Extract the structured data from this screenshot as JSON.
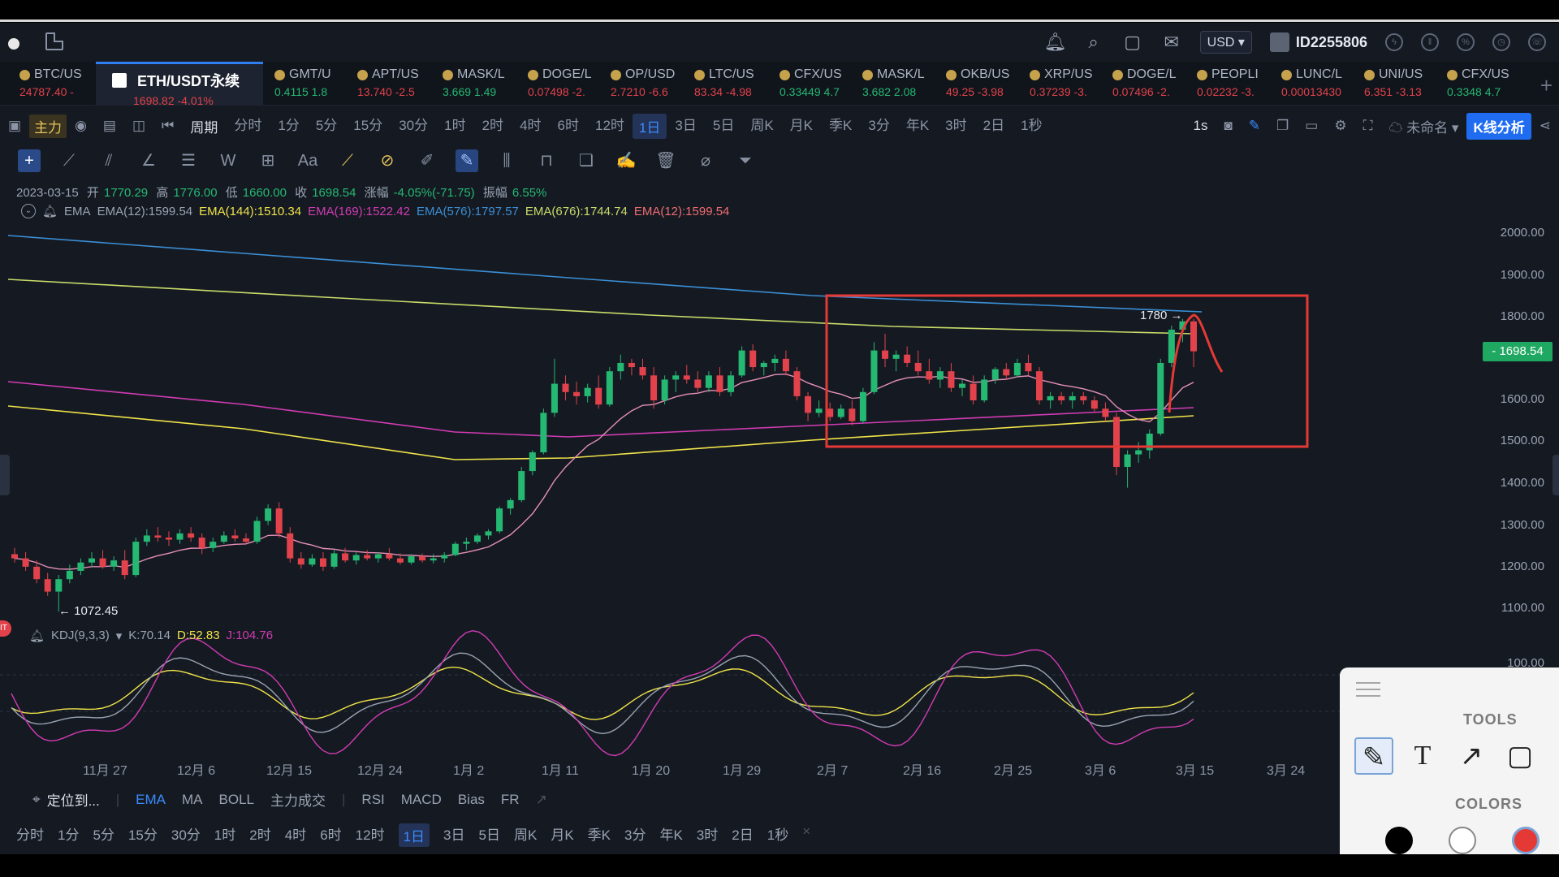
{
  "colors": {
    "up": "#25b873",
    "down": "#e2424b",
    "accent": "#2f7ff2",
    "bg": "#151a22"
  },
  "header": {
    "currency": "USD ▾",
    "user_id": "ID2255806",
    "icons": [
      "bell-icon",
      "search-icon",
      "gift-icon",
      "mail-icon"
    ]
  },
  "tabs": [
    {
      "name": "BTC/US",
      "price": "24787.40 -"
    },
    {
      "name": "ETH/USDT永续",
      "price": "1698.82 -4.01%"
    },
    {
      "name": "GMT/U",
      "price": "0.4115 1.8"
    },
    {
      "name": "APT/US",
      "price": "13.740 -2.5"
    },
    {
      "name": "MASK/L",
      "price": "3.669 1.49"
    },
    {
      "name": "DOGE/L",
      "price": "0.07498 -2."
    },
    {
      "name": "OP/USD",
      "price": "2.7210 -6.6"
    },
    {
      "name": "LTC/US",
      "price": "83.34 -4.98"
    },
    {
      "name": "CFX/US",
      "price": "0.33449 4.7"
    },
    {
      "name": "MASK/L",
      "price": "3.682 2.08"
    },
    {
      "name": "OKB/US",
      "price": "49.25 -3.98"
    },
    {
      "name": "XRP/US",
      "price": "0.37239 -3."
    },
    {
      "name": "DOGE/L",
      "price": "0.07496 -2."
    },
    {
      "name": "PEOPLI",
      "price": "0.02232 -3."
    },
    {
      "name": "LUNC/L",
      "price": "0.00013430"
    },
    {
      "name": "UNI/US",
      "price": "6.351 -3.13"
    },
    {
      "name": "CFX/US",
      "price": "0.3348 4.7"
    }
  ],
  "toolbar": {
    "main": "主力",
    "period": "周期",
    "periods": [
      "分时",
      "1分",
      "5分",
      "15分",
      "30分",
      "1时",
      "2时",
      "4时",
      "6时",
      "12时",
      "1日",
      "3日",
      "5日",
      "周K",
      "月K",
      "季K",
      "3分",
      "年K",
      "3时",
      "2日",
      "1秒"
    ],
    "selected": "1日",
    "interval": "1s",
    "layout_name": "未命名",
    "kline_btn": "K线分析"
  },
  "ohlc": {
    "date": "2023-03-15",
    "open_label": "开",
    "open": "1770.29",
    "high_label": "高",
    "high": "1776.00",
    "low_label": "低",
    "low": "1660.00",
    "close_label": "收",
    "close": "1698.54",
    "chg_label": "涨幅",
    "chg": "-4.05%(-71.75)",
    "amp_label": "振幅",
    "amp": "6.55%"
  },
  "ema": {
    "name": "EMA",
    "values": [
      "EMA(12):1599.54",
      "EMA(144):1510.34",
      "EMA(169):1522.42",
      "EMA(576):1797.57",
      "EMA(676):1744.74",
      "EMA(12):1599.54"
    ]
  },
  "y_axis": [
    "2000.00",
    "1900.00",
    "1800.00",
    "1700.00",
    "1600.00",
    "1500.00",
    "1400.00",
    "1300.00",
    "1200.00",
    "1100.00",
    "100.00"
  ],
  "price_tag": "- 1698.54",
  "annot": {
    "high": "1780 →",
    "low": "← 1072.45"
  },
  "x_axis": [
    "11月 27",
    "12月 6",
    "12月 15",
    "12月 24",
    "1月 2",
    "1月 11",
    "1月 20",
    "1月 29",
    "2月 7",
    "2月 16",
    "2月 25",
    "3月 6",
    "3月 15",
    "3月 24"
  ],
  "kdj": {
    "name": "KDJ(9,3,3)",
    "k": "K:70.14",
    "d": "D:52.83",
    "j": "J:104.76"
  },
  "indicators": {
    "locate": "定位到...",
    "items": [
      "EMA",
      "MA",
      "BOLL",
      "主力成交",
      "RSI",
      "MACD",
      "Bias",
      "FR"
    ]
  },
  "bottom_periods": [
    "分时",
    "1分",
    "5分",
    "15分",
    "30分",
    "1时",
    "2时",
    "4时",
    "6时",
    "12时",
    "1日",
    "3日",
    "5日",
    "周K",
    "月K",
    "季K",
    "3分",
    "年K",
    "3时",
    "2日",
    "1秒"
  ],
  "panel": {
    "tools_label": "TOOLS",
    "colors_label": "COLORS"
  },
  "candles": [
    [
      1210,
      1225,
      1190,
      1200
    ],
    [
      1200,
      1215,
      1170,
      1180
    ],
    [
      1180,
      1195,
      1140,
      1150
    ],
    [
      1150,
      1165,
      1110,
      1120
    ],
    [
      1120,
      1160,
      1072,
      1150
    ],
    [
      1150,
      1185,
      1140,
      1170
    ],
    [
      1170,
      1200,
      1160,
      1190
    ],
    [
      1190,
      1215,
      1180,
      1200
    ],
    [
      1200,
      1220,
      1175,
      1180
    ],
    [
      1180,
      1205,
      1170,
      1195
    ],
    [
      1195,
      1220,
      1150,
      1160
    ],
    [
      1160,
      1250,
      1155,
      1240
    ],
    [
      1240,
      1270,
      1230,
      1255
    ],
    [
      1255,
      1275,
      1240,
      1250
    ],
    [
      1250,
      1265,
      1230,
      1245
    ],
    [
      1245,
      1270,
      1235,
      1260
    ],
    [
      1260,
      1275,
      1240,
      1250
    ],
    [
      1250,
      1260,
      1210,
      1225
    ],
    [
      1225,
      1250,
      1215,
      1240
    ],
    [
      1240,
      1265,
      1235,
      1255
    ],
    [
      1255,
      1270,
      1240,
      1248
    ],
    [
      1248,
      1260,
      1235,
      1240
    ],
    [
      1240,
      1300,
      1235,
      1290
    ],
    [
      1290,
      1330,
      1280,
      1320
    ],
    [
      1320,
      1335,
      1250,
      1260
    ],
    [
      1260,
      1275,
      1190,
      1200
    ],
    [
      1200,
      1215,
      1175,
      1185
    ],
    [
      1185,
      1210,
      1180,
      1200
    ],
    [
      1200,
      1215,
      1170,
      1180
    ],
    [
      1180,
      1220,
      1175,
      1212
    ],
    [
      1212,
      1225,
      1190,
      1195
    ],
    [
      1195,
      1215,
      1185,
      1208
    ],
    [
      1208,
      1220,
      1195,
      1200
    ],
    [
      1200,
      1215,
      1190,
      1210
    ],
    [
      1210,
      1225,
      1195,
      1200
    ],
    [
      1200,
      1212,
      1185,
      1190
    ],
    [
      1190,
      1210,
      1185,
      1205
    ],
    [
      1205,
      1212,
      1190,
      1195
    ],
    [
      1195,
      1210,
      1188,
      1200
    ],
    [
      1200,
      1215,
      1190,
      1208
    ],
    [
      1208,
      1240,
      1205,
      1235
    ],
    [
      1235,
      1250,
      1220,
      1240
    ],
    [
      1240,
      1260,
      1235,
      1255
    ],
    [
      1255,
      1270,
      1245,
      1265
    ],
    [
      1265,
      1325,
      1260,
      1320
    ],
    [
      1320,
      1345,
      1305,
      1340
    ],
    [
      1340,
      1420,
      1335,
      1410
    ],
    [
      1410,
      1460,
      1400,
      1455
    ],
    [
      1455,
      1560,
      1450,
      1550
    ],
    [
      1550,
      1680,
      1540,
      1620
    ],
    [
      1620,
      1640,
      1580,
      1600
    ],
    [
      1600,
      1625,
      1570,
      1590
    ],
    [
      1590,
      1620,
      1575,
      1610
    ],
    [
      1610,
      1640,
      1560,
      1570
    ],
    [
      1570,
      1660,
      1565,
      1650
    ],
    [
      1650,
      1690,
      1630,
      1670
    ],
    [
      1670,
      1680,
      1640,
      1660
    ],
    [
      1660,
      1680,
      1630,
      1640
    ],
    [
      1640,
      1660,
      1560,
      1580
    ],
    [
      1580,
      1640,
      1570,
      1630
    ],
    [
      1630,
      1650,
      1600,
      1640
    ],
    [
      1640,
      1665,
      1620,
      1630
    ],
    [
      1630,
      1650,
      1600,
      1610
    ],
    [
      1610,
      1650,
      1600,
      1640
    ],
    [
      1640,
      1660,
      1590,
      1600
    ],
    [
      1600,
      1650,
      1590,
      1640
    ],
    [
      1640,
      1710,
      1635,
      1700
    ],
    [
      1700,
      1715,
      1650,
      1660
    ],
    [
      1660,
      1675,
      1640,
      1670
    ],
    [
      1670,
      1690,
      1650,
      1680
    ],
    [
      1680,
      1700,
      1640,
      1650
    ],
    [
      1650,
      1660,
      1580,
      1590
    ],
    [
      1590,
      1600,
      1530,
      1550
    ],
    [
      1550,
      1580,
      1540,
      1560
    ],
    [
      1560,
      1575,
      1530,
      1540
    ],
    [
      1540,
      1570,
      1535,
      1560
    ],
    [
      1560,
      1580,
      1520,
      1530
    ],
    [
      1530,
      1610,
      1525,
      1600
    ],
    [
      1600,
      1720,
      1595,
      1700
    ],
    [
      1700,
      1740,
      1660,
      1680
    ],
    [
      1680,
      1700,
      1650,
      1690
    ],
    [
      1690,
      1710,
      1660,
      1670
    ],
    [
      1670,
      1700,
      1640,
      1650
    ],
    [
      1650,
      1680,
      1620,
      1630
    ],
    [
      1630,
      1660,
      1610,
      1650
    ],
    [
      1650,
      1670,
      1600,
      1610
    ],
    [
      1610,
      1630,
      1590,
      1620
    ],
    [
      1620,
      1640,
      1570,
      1580
    ],
    [
      1580,
      1640,
      1575,
      1630
    ],
    [
      1630,
      1660,
      1620,
      1655
    ],
    [
      1655,
      1670,
      1630,
      1640
    ],
    [
      1640,
      1680,
      1635,
      1670
    ],
    [
      1670,
      1690,
      1640,
      1650
    ],
    [
      1650,
      1660,
      1570,
      1580
    ],
    [
      1580,
      1600,
      1560,
      1590
    ],
    [
      1590,
      1600,
      1570,
      1580
    ],
    [
      1580,
      1600,
      1560,
      1590
    ],
    [
      1590,
      1600,
      1570,
      1580
    ],
    [
      1580,
      1590,
      1550,
      1560
    ],
    [
      1560,
      1575,
      1530,
      1540
    ],
    [
      1540,
      1550,
      1400,
      1420
    ],
    [
      1420,
      1460,
      1370,
      1450
    ],
    [
      1450,
      1480,
      1430,
      1460
    ],
    [
      1460,
      1510,
      1440,
      1500
    ],
    [
      1500,
      1680,
      1495,
      1670
    ],
    [
      1670,
      1760,
      1660,
      1750
    ],
    [
      1750,
      1776,
      1720,
      1770
    ],
    [
      1770,
      1776,
      1660,
      1698
    ]
  ]
}
